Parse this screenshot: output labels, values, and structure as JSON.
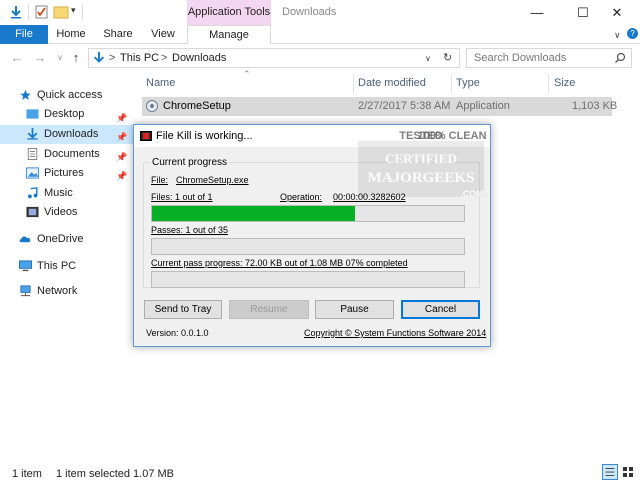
{
  "window": {
    "title": "Downloads",
    "context_tab_group": "Application Tools",
    "minimize": "—",
    "maximize": "☐",
    "close": "✕"
  },
  "ribbon": {
    "tabs": [
      "File",
      "Home",
      "Share",
      "View",
      "Manage"
    ]
  },
  "address": {
    "crumbs": [
      "This PC",
      "Downloads"
    ],
    "separator": ">",
    "search_placeholder": "Search Downloads"
  },
  "nav": {
    "quick_access": "Quick access",
    "items": [
      "Desktop",
      "Downloads",
      "Documents",
      "Pictures",
      "Music",
      "Videos"
    ],
    "onedrive": "OneDrive",
    "this_pc": "This PC",
    "network": "Network"
  },
  "columns": {
    "name": "Name",
    "date": "Date modified",
    "type": "Type",
    "size": "Size"
  },
  "files": [
    {
      "name": "ChromeSetup",
      "date": "2/27/2017 5:38 AM",
      "type": "Application",
      "size": "1,103 KB"
    }
  ],
  "dialog": {
    "title": "File Kill is working...",
    "group_label": "Current progress",
    "file_label": "File:",
    "file_value": "ChromeSetup.exe",
    "files_text": "Files: 1 out of 1",
    "operation_label": "Operation:",
    "operation_value": "00:00:00.3282602",
    "passes_text": "Passes: 1 out of 35",
    "pass_progress_text": "Current pass progress: 72.00 KB out of 1.08 MB 07% completed",
    "files_progress": 0.65,
    "passes_progress": 0.0,
    "pass_progress": 0.0,
    "buttons": [
      "Send to Tray",
      "Resume",
      "Pause",
      "Cancel"
    ],
    "version": "Version: 0.0.1.0",
    "copyright": "Copyright © System Functions Software 2014"
  },
  "watermark": {
    "line1": "TESTED",
    "line2": "100% CLEAN",
    "line3": "CERTIFIED",
    "line4": "MAJORGEEKS",
    "line5": ".COM"
  },
  "statusbar": {
    "count": "1 item",
    "selection": "1 item selected  1.07 MB"
  },
  "colors": {
    "accent": "#1979ca",
    "progress": "#06b025",
    "selected": "#cce8ff"
  }
}
